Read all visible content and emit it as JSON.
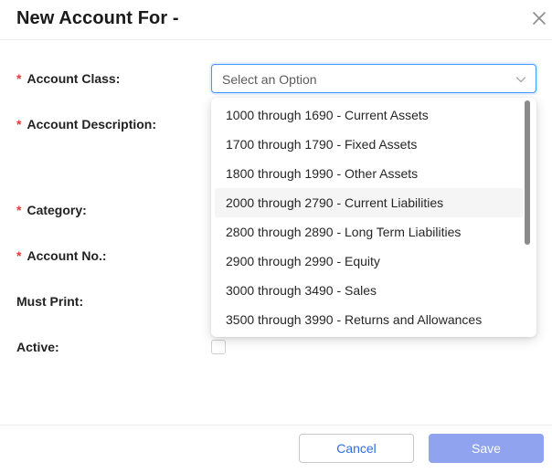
{
  "modal": {
    "title": "New Account For -"
  },
  "form": {
    "required_mark": "*",
    "account_class_label": "Account Class",
    "account_description_label": "Account Description",
    "category_label": "Category",
    "account_no_label": "Account No.",
    "must_print_label": "Must Print",
    "active_label": "Active",
    "label_suffix": ":",
    "active_checked": false
  },
  "account_class_select": {
    "placeholder": "Select an Option",
    "options": [
      "1000 through 1690 - Current Assets",
      "1700 through 1790 - Fixed Assets",
      "1800 through 1990 - Other Assets",
      "2000 through 2790 - Current Liabilities",
      "2800 through 2890 - Long Term Liabilities",
      "2900 through 2990 - Equity",
      "3000 through 3490 - Sales",
      "3500 through 3990 - Returns and Allowances"
    ],
    "highlighted_option": "2000 through 2790 - Current Liabilities"
  },
  "footer": {
    "cancel_label": "Cancel",
    "save_label": "Save"
  },
  "colors": {
    "required": "#e53935",
    "focus_border": "#4096ff",
    "cancel_text": "#2f6ee0",
    "save_bg": "#8fa3ef"
  }
}
